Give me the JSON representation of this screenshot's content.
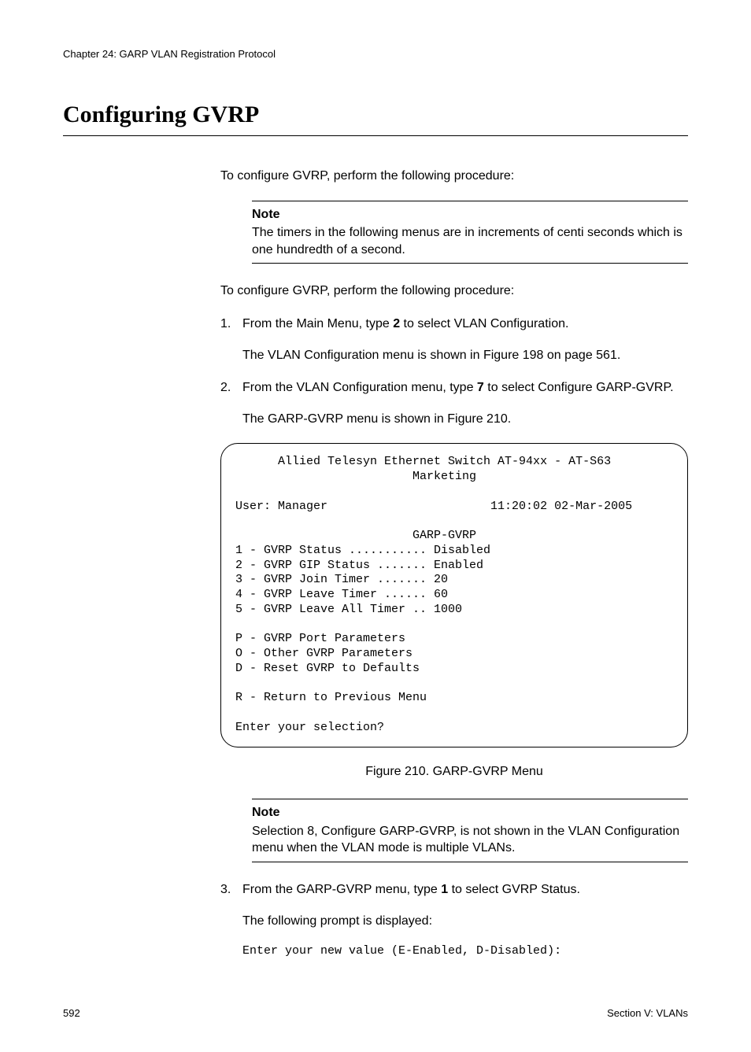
{
  "header": {
    "chapter_line": "Chapter 24: GARP VLAN Registration Protocol"
  },
  "title": "Configuring GVRP",
  "intro_para": "To configure GVRP, perform the following procedure:",
  "note1": {
    "label": "Note",
    "text": "The timers in the following menus are in increments of centi seconds which is one hundredth of a second."
  },
  "intro_para2": "To configure GVRP, perform the following procedure:",
  "steps": {
    "s1": {
      "num": "1.",
      "pre": "From the Main Menu, type ",
      "bold": "2",
      "post": " to select VLAN Configuration.",
      "sub": "The VLAN Configuration menu is shown in Figure 198 on page 561."
    },
    "s2": {
      "num": "2.",
      "pre": "From the VLAN Configuration menu, type ",
      "bold": "7",
      "post": " to select Configure GARP-GVRP.",
      "sub": "The GARP-GVRP menu is shown in Figure 210."
    },
    "s3": {
      "num": "3.",
      "pre": "From the GARP-GVRP menu, type ",
      "bold": "1",
      "post": " to select GVRP Status.",
      "sub": "The following prompt is displayed:",
      "prompt": "Enter your new value (E-Enabled, D-Disabled):"
    }
  },
  "terminal": {
    "title_line": "      Allied Telesyn Ethernet Switch AT-94xx - AT-S63",
    "subtitle": "                         Marketing",
    "blank": "",
    "user_line": "User: Manager                       11:20:02 02-Mar-2005",
    "menu_name": "                         GARP-GVRP",
    "opt1": "1 - GVRP Status ........... Disabled",
    "opt2": "2 - GVRP GIP Status ....... Enabled",
    "opt3": "3 - GVRP Join Timer ....... 20",
    "opt4": "4 - GVRP Leave Timer ...... 60",
    "opt5": "5 - GVRP Leave All Timer .. 1000",
    "optP": "P - GVRP Port Parameters",
    "optO": "O - Other GVRP Parameters",
    "optD": "D - Reset GVRP to Defaults",
    "optR": "R - Return to Previous Menu",
    "prompt": "Enter your selection?"
  },
  "figure_caption": "Figure 210. GARP-GVRP Menu",
  "note2": {
    "label": "Note",
    "text": "Selection 8, Configure GARP-GVRP, is not shown in the VLAN Configuration menu when the VLAN mode is multiple VLANs."
  },
  "footer": {
    "page": "592",
    "section": "Section V: VLANs"
  }
}
